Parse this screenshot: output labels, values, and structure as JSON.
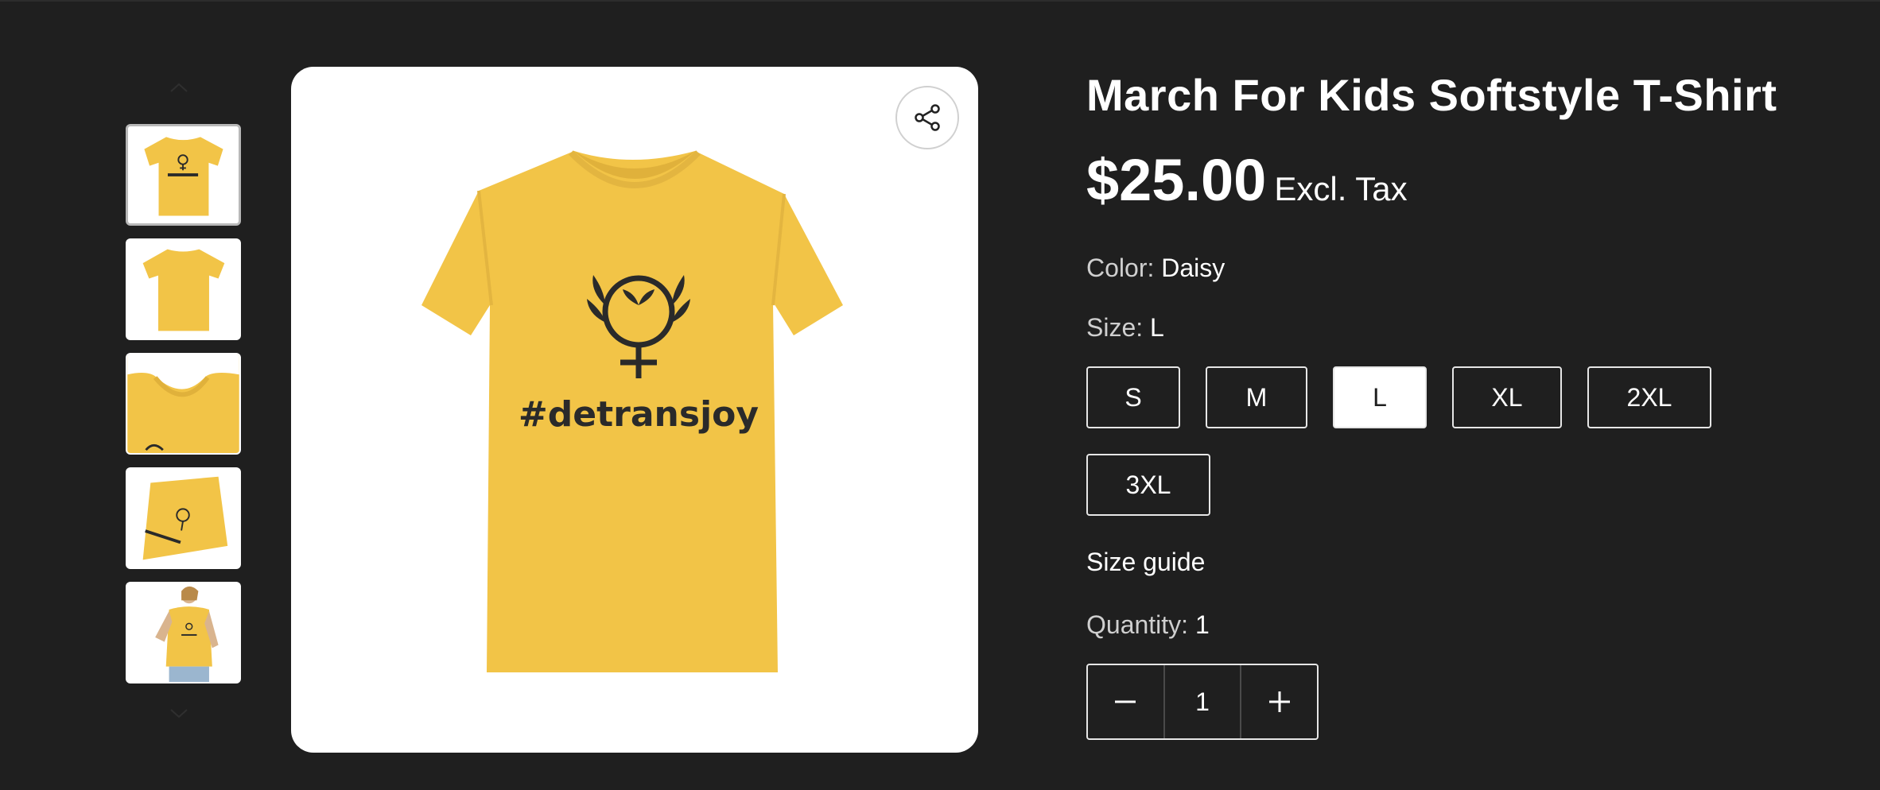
{
  "product": {
    "title": "March For Kids Softstyle T-Shirt",
    "price": "$25.00",
    "tax_note": "Excl. Tax",
    "image_text": "#detransjoy",
    "shirt_color": "#f2c447",
    "print_color": "#2a2a2a"
  },
  "options": {
    "color_label": "Color:",
    "color_value": "Daisy",
    "size_label": "Size:",
    "size_value": "L",
    "sizes": [
      "S",
      "M",
      "L",
      "XL",
      "2XL",
      "3XL"
    ],
    "selected_size": "L",
    "size_guide": "Size guide"
  },
  "quantity": {
    "label": "Quantity:",
    "value": "1"
  },
  "icons": {
    "share": "share-icon",
    "minus": "minus-icon",
    "plus": "plus-icon",
    "nav_up": "chevron-up-icon",
    "nav_down": "chevron-down-icon"
  },
  "gallery": {
    "thumbnail_count": 5,
    "active_index": 0
  }
}
